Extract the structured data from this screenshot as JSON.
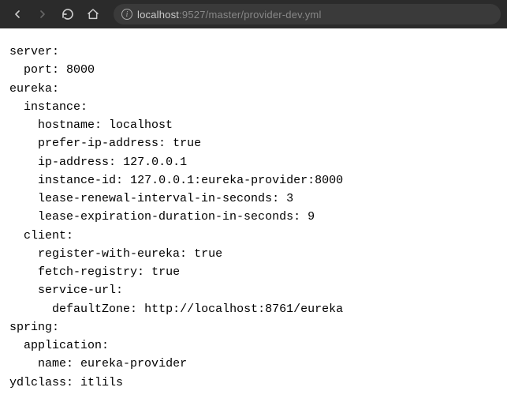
{
  "toolbar": {
    "url_host": "localhost",
    "url_port": ":9527",
    "url_path": "/master/provider-dev.yml"
  },
  "yaml": {
    "server": {
      "key": "server:",
      "port_key": "port:",
      "port_value": "8000"
    },
    "eureka": {
      "key": "eureka:",
      "instance": {
        "key": "instance:",
        "hostname_key": "hostname:",
        "hostname_value": "localhost",
        "prefer_ip_key": "prefer-ip-address:",
        "prefer_ip_value": "true",
        "ip_address_key": "ip-address:",
        "ip_address_value": "127.0.0.1",
        "instance_id_key": "instance-id:",
        "instance_id_value": "127.0.0.1:eureka-provider:8000",
        "lease_renewal_key": "lease-renewal-interval-in-seconds:",
        "lease_renewal_value": "3",
        "lease_expiration_key": "lease-expiration-duration-in-seconds:",
        "lease_expiration_value": "9"
      },
      "client": {
        "key": "client:",
        "register_key": "register-with-eureka:",
        "register_value": "true",
        "fetch_key": "fetch-registry:",
        "fetch_value": "true",
        "service_url_key": "service-url:",
        "default_zone_key": "defaultZone:",
        "default_zone_value": "http://localhost:8761/eureka"
      }
    },
    "spring": {
      "key": "spring:",
      "application_key": "application:",
      "name_key": "name:",
      "name_value": "eureka-provider"
    },
    "ydlclass": {
      "key": "ydlclass:",
      "value": "itlils"
    }
  }
}
